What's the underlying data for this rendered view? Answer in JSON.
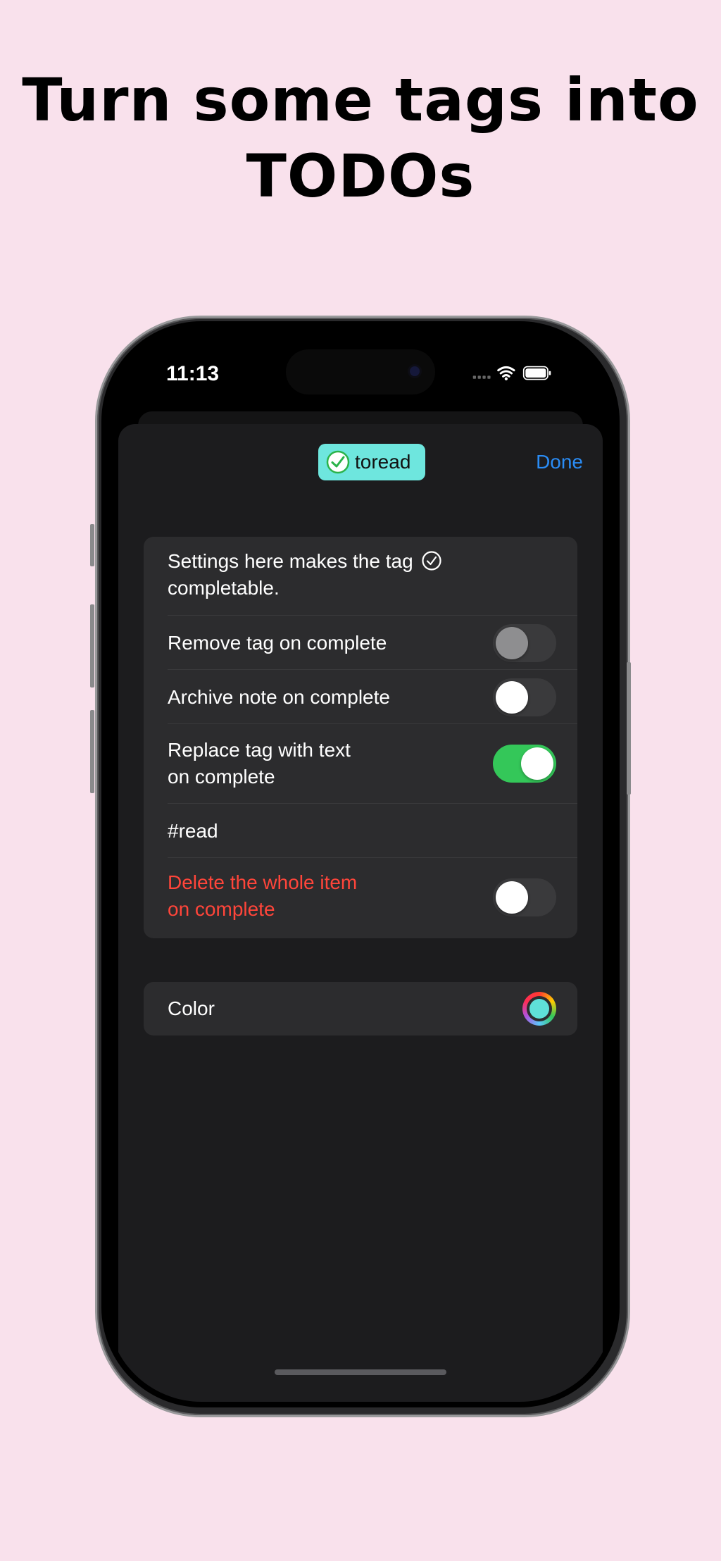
{
  "headline": {
    "line1": "Turn some tags into",
    "line2": "TODOs"
  },
  "status_bar": {
    "time": "11:13"
  },
  "header": {
    "tag_name": "toread",
    "tag_color": "#6ee6de",
    "done_label": "Done"
  },
  "settings": {
    "intro_line1": "Settings here makes the tag",
    "intro_line2": "completable.",
    "remove_tag": {
      "label": "Remove tag on complete",
      "on": false,
      "disabled": true
    },
    "archive_note": {
      "label": "Archive note on complete",
      "on": false
    },
    "replace_tag": {
      "label_line1": "Replace tag with text",
      "label_line2": "on complete",
      "on": true
    },
    "replacement_text": "#read",
    "delete_item": {
      "label_line1": "Delete the whole item",
      "label_line2": "on complete",
      "on": false
    }
  },
  "color_group": {
    "label": "Color",
    "value": "#5fe0d8"
  }
}
